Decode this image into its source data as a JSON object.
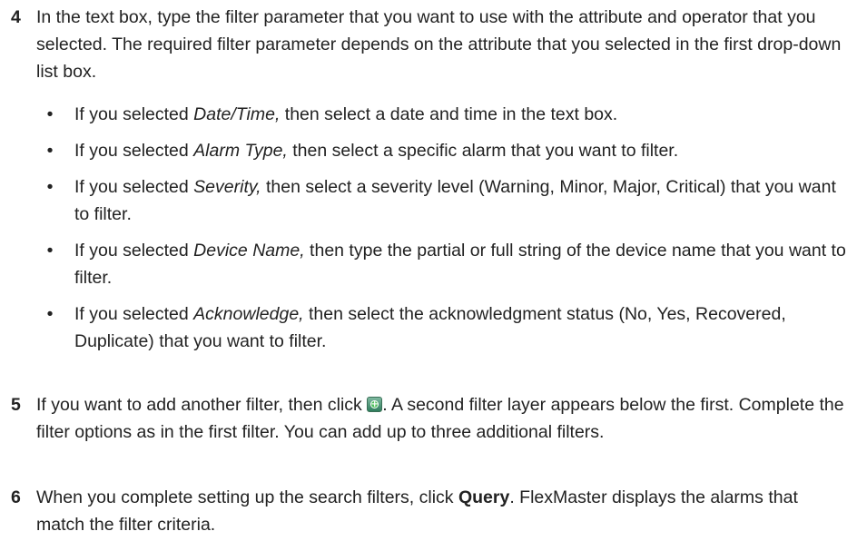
{
  "steps": [
    {
      "number": "4",
      "text": "In the text box, type the filter parameter that you want to use with the attribute and operator that you selected. The required filter parameter depends on the attribute that you selected in the first drop-down list box.",
      "bullets": [
        {
          "prefix": "If you selected ",
          "term": "Date/Time,",
          "rest": " then select a date and time in the text box."
        },
        {
          "prefix": "If you selected ",
          "term": "Alarm Type,",
          "rest": " then select a specific alarm that you want to filter."
        },
        {
          "prefix": "If you selected ",
          "term": "Severity,",
          "rest": " then select a severity level (Warning, Minor, Major, Critical) that you want to filter."
        },
        {
          "prefix": "If you selected ",
          "term": "Device Name,",
          "rest": " then type the partial or full string of the device name that you want to filter."
        },
        {
          "prefix": "If you selected ",
          "term": "Acknowledge,",
          "rest": " then select the acknowledgment status (No, Yes, Recovered, Duplicate) that you want to filter."
        }
      ]
    },
    {
      "number": "5",
      "text_before_icon": "If you want to add another filter, then click ",
      "icon": "add-filter-icon",
      "text_after_icon": ". A second filter layer appears below the first. Complete the filter options as in the first filter. You can add up to three additional filters."
    },
    {
      "number": "6",
      "text_before_bold": "When you complete setting up the search filters, click ",
      "bold": "Query",
      "text_after_bold": ". FlexMaster displays the alarms that match the filter criteria."
    }
  ],
  "bullet_char": "•"
}
